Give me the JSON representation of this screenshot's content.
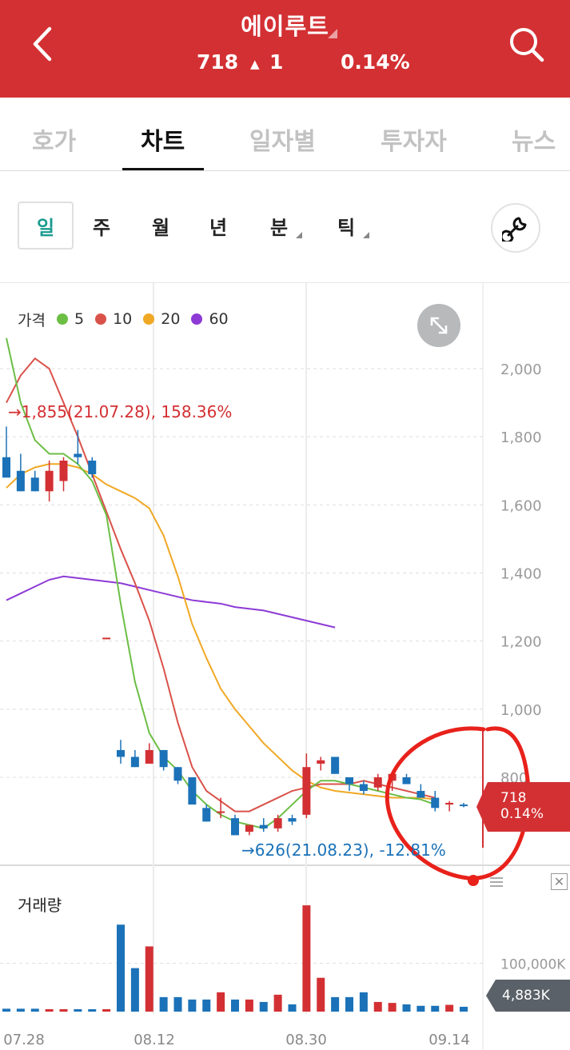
{
  "header": {
    "stock_name": "에이루트",
    "price": "718",
    "change_arrow": "▲",
    "change": "1",
    "change_pct": "0.14%",
    "back_icon": "chevron-left-icon",
    "search_icon": "search-icon",
    "bg_color": "#d33033"
  },
  "tabs": [
    {
      "label": "호가",
      "active": false
    },
    {
      "label": "차트",
      "active": true
    },
    {
      "label": "일자별",
      "active": false
    },
    {
      "label": "투자자",
      "active": false
    },
    {
      "label": "뉴스",
      "active": false
    }
  ],
  "periods": [
    {
      "label": "일",
      "active": true
    },
    {
      "label": "주"
    },
    {
      "label": "월"
    },
    {
      "label": "년"
    },
    {
      "label": "분",
      "has_menu": true
    },
    {
      "label": "틱",
      "has_menu": true
    }
  ],
  "settings_icon": "wrench-icon",
  "expand_icon": "expand-arrows-icon",
  "legend": {
    "price_label": "가격",
    "ma": [
      {
        "label": "5",
        "color": "#6cbe45"
      },
      {
        "label": "10",
        "color": "#d9524a"
      },
      {
        "label": "20",
        "color": "#f0a824"
      },
      {
        "label": "60",
        "color": "#8d3ad6"
      }
    ]
  },
  "annotations": {
    "high": "→1,855(21.07.28), 158.36%",
    "low": "→626(21.08.23), -12.81%"
  },
  "price_axis": [
    "2,000",
    "1,800",
    "1,600",
    "1,400",
    "1,200",
    "1,000",
    "800"
  ],
  "current_price_tag": {
    "price": "718",
    "pct": "0.14%"
  },
  "volume": {
    "label": "거래량",
    "axis_label": "100,000K",
    "current_tag": "4,883K",
    "close_icon": "close-icon",
    "menu_icon": "menu-icon"
  },
  "date_axis": [
    "07.28",
    "08.12",
    "08.30",
    "09.14"
  ],
  "colors": {
    "up": "#d33033",
    "down": "#1b72b8",
    "annotation_circle": "#e8211b"
  },
  "chart_data": {
    "type": "candlestick",
    "y_range": [
      580,
      2100
    ],
    "x_ticks": [
      "07.28",
      "08.12",
      "08.30",
      "09.14"
    ],
    "candles": [
      {
        "o": 1740,
        "h": 1830,
        "l": 1700,
        "c": 1680
      },
      {
        "o": 1700,
        "h": 1750,
        "l": 1640,
        "c": 1640
      },
      {
        "o": 1680,
        "h": 1700,
        "l": 1640,
        "c": 1640
      },
      {
        "o": 1640,
        "h": 1730,
        "l": 1610,
        "c": 1700
      },
      {
        "o": 1670,
        "h": 1740,
        "l": 1640,
        "c": 1730
      },
      {
        "o": 1750,
        "h": 1820,
        "l": 1720,
        "c": 1740
      },
      {
        "o": 1730,
        "h": 1740,
        "l": 1680,
        "c": 1690
      },
      {
        "o": 1210,
        "h": 1210,
        "l": 1210,
        "c": 1210
      },
      {
        "o": 880,
        "h": 910,
        "l": 840,
        "c": 860
      },
      {
        "o": 860,
        "h": 880,
        "l": 830,
        "c": 830
      },
      {
        "o": 840,
        "h": 900,
        "l": 840,
        "c": 880
      },
      {
        "o": 880,
        "h": 880,
        "l": 820,
        "c": 830
      },
      {
        "o": 830,
        "h": 830,
        "l": 780,
        "c": 790
      },
      {
        "o": 800,
        "h": 800,
        "l": 720,
        "c": 720
      },
      {
        "o": 710,
        "h": 720,
        "l": 670,
        "c": 670
      },
      {
        "o": 700,
        "h": 740,
        "l": 680,
        "c": 700
      },
      {
        "o": 680,
        "h": 690,
        "l": 630,
        "c": 630
      },
      {
        "o": 640,
        "h": 660,
        "l": 630,
        "c": 660
      },
      {
        "o": 660,
        "h": 680,
        "l": 640,
        "c": 650
      },
      {
        "o": 650,
        "h": 690,
        "l": 640,
        "c": 680
      },
      {
        "o": 680,
        "h": 690,
        "l": 660,
        "c": 670
      },
      {
        "o": 690,
        "h": 870,
        "l": 680,
        "c": 830
      },
      {
        "o": 840,
        "h": 860,
        "l": 820,
        "c": 850
      },
      {
        "o": 860,
        "h": 860,
        "l": 810,
        "c": 810
      },
      {
        "o": 800,
        "h": 800,
        "l": 760,
        "c": 780
      },
      {
        "o": 780,
        "h": 790,
        "l": 750,
        "c": 760
      },
      {
        "o": 770,
        "h": 810,
        "l": 760,
        "c": 800
      },
      {
        "o": 790,
        "h": 810,
        "l": 760,
        "c": 810
      },
      {
        "o": 800,
        "h": 810,
        "l": 780,
        "c": 780
      },
      {
        "o": 760,
        "h": 780,
        "l": 740,
        "c": 740
      },
      {
        "o": 740,
        "h": 760,
        "l": 700,
        "c": 710
      },
      {
        "o": 720,
        "h": 730,
        "l": 700,
        "c": 725
      },
      {
        "o": 720,
        "h": 725,
        "l": 712,
        "c": 718
      }
    ],
    "ma5": [
      2090,
      1900,
      1790,
      1750,
      1750,
      1720,
      1670,
      1570,
      1310,
      1080,
      930,
      860,
      820,
      760,
      720,
      690,
      670,
      660,
      650,
      680,
      720,
      760,
      790,
      790,
      780,
      770,
      760,
      750,
      740,
      735,
      720
    ],
    "ma10": [
      1900,
      1980,
      2030,
      2000,
      1900,
      1800,
      1690,
      1580,
      1470,
      1370,
      1260,
      1120,
      960,
      830,
      760,
      730,
      700,
      700,
      720,
      740,
      760,
      770,
      780,
      780,
      780,
      790,
      780,
      770,
      760,
      750,
      740
    ],
    "ma20": [
      1650,
      1690,
      1710,
      1720,
      1720,
      1710,
      1690,
      1660,
      1640,
      1620,
      1590,
      1510,
      1390,
      1250,
      1150,
      1060,
      1000,
      950,
      900,
      860,
      820,
      790,
      770,
      760,
      755,
      750,
      745,
      740,
      740,
      740,
      735
    ],
    "ma60": [
      1320,
      1340,
      1360,
      1380,
      1390,
      1385,
      1380,
      1375,
      1370,
      1360,
      1350,
      1340,
      1330,
      1320,
      1315,
      1310,
      1300,
      1295,
      1290,
      1280,
      1270,
      1260,
      1250,
      1240
    ],
    "volume": [
      6,
      6,
      6,
      5,
      5,
      5,
      5,
      5,
      180,
      90,
      135,
      30,
      30,
      25,
      25,
      40,
      25,
      25,
      20,
      35,
      15,
      220,
      70,
      30,
      30,
      40,
      20,
      18,
      15,
      12,
      12,
      14,
      10
    ]
  }
}
